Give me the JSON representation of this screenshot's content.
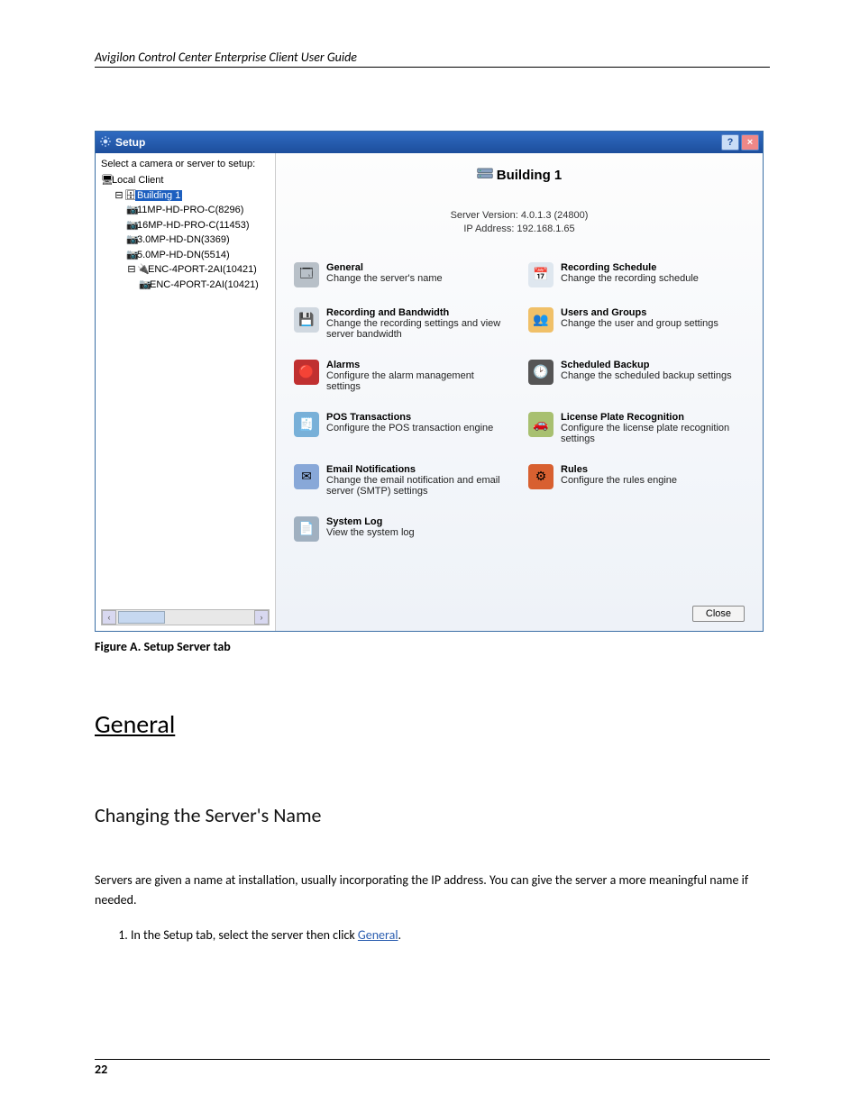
{
  "page": {
    "header": "Avigilon Control Center Enterprise Client User Guide",
    "figure_caption": "Figure A. Setup Server tab",
    "body_paragraph": "Servers are given a name at installation, usually incorporating the IP address. You can give the server a more meaningful name if needed.",
    "section_h1": "General",
    "section_h2": "Changing the Server's Name",
    "step1_prefix": "In the Setup tab, select the server then click ",
    "step1_link": "General",
    "step1_suffix": ".",
    "footer_page": "22"
  },
  "window": {
    "title": "Setup",
    "help_glyph": "?",
    "close_glyph": "×",
    "tree_label": "Select a camera or server to setup:",
    "tree": {
      "root": "Local Client",
      "building": "Building 1",
      "cams": [
        "11MP-HD-PRO-C(8296)",
        "16MP-HD-PRO-C(11453)",
        "3.0MP-HD-DN(3369)",
        "5.0MP-HD-DN(5514)"
      ],
      "enc_parent": "ENC-4PORT-2AI(10421)",
      "enc_child": "ENC-4PORT-2AI(10421)"
    },
    "scroll_left": "‹",
    "scroll_right": "›",
    "server_name": "Building 1",
    "server_version_label": "Server Version: 4.0.1.3 (24800)",
    "server_ip_label": "IP Address: 192.168.1.65",
    "items": [
      {
        "title": "General",
        "desc": "Change the server's name",
        "color": "#b8c0c8",
        "glyph": "🗔"
      },
      {
        "title": "Recording Schedule",
        "desc": "Change the recording schedule",
        "color": "#dfe7ef",
        "glyph": "📅"
      },
      {
        "title": "Recording and Bandwidth",
        "desc": "Change the recording settings and view server bandwidth",
        "color": "#d0d8e0",
        "glyph": "💾"
      },
      {
        "title": "Users and Groups",
        "desc": "Change the user and group settings",
        "color": "#f0c068",
        "glyph": "👥"
      },
      {
        "title": "Alarms",
        "desc": "Configure the alarm management settings",
        "color": "#c03030",
        "glyph": "🔴"
      },
      {
        "title": "Scheduled Backup",
        "desc": "Change the scheduled backup settings",
        "color": "#555",
        "glyph": "🕑"
      },
      {
        "title": "POS Transactions",
        "desc": "Configure the POS transaction engine",
        "color": "#78b0d8",
        "glyph": "🧾"
      },
      {
        "title": "License Plate Recognition",
        "desc": "Configure the license plate recognition settings",
        "color": "#a8c070",
        "glyph": "🚗"
      },
      {
        "title": "Email Notifications",
        "desc": "Change the email notification and email server (SMTP) settings",
        "color": "#88a8d8",
        "glyph": "✉"
      },
      {
        "title": "Rules",
        "desc": "Configure the rules engine",
        "color": "#d86030",
        "glyph": "⚙"
      },
      {
        "title": "System Log",
        "desc": "View the system log",
        "color": "#a0b0c0",
        "glyph": "📄"
      }
    ],
    "close_button": "Close"
  }
}
